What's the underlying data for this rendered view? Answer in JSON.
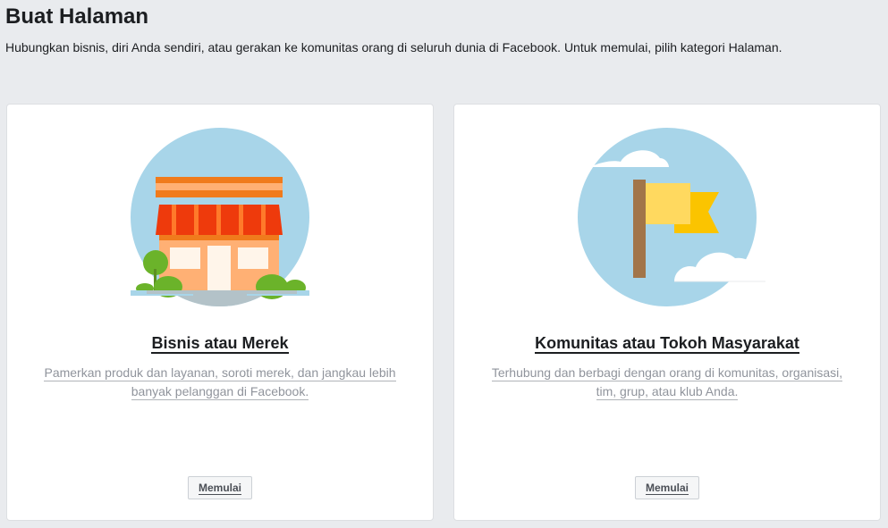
{
  "header": {
    "title": "Buat Halaman",
    "subtitle": "Hubungkan bisnis, diri Anda sendiri, atau gerakan ke komunitas orang di seluruh dunia di Facebook. Untuk memulai, pilih kategori Halaman."
  },
  "cards": [
    {
      "title": "Bisnis atau Merek",
      "description": "Pamerkan produk dan layanan, soroti merek, dan jangkau lebih banyak pelanggan di Facebook.",
      "button_label": "Memulai",
      "illustration": "storefront-icon"
    },
    {
      "title": "Komunitas atau Tokoh Masyarakat",
      "description": "Terhubung dan berbagi dengan orang di komunitas, organisasi, tim, grup, atau klub Anda.",
      "button_label": "Memulai",
      "illustration": "flag-icon"
    }
  ],
  "colors": {
    "page_background": "#e9ebee",
    "card_background": "#ffffff",
    "sky_blue": "#a8d5e9",
    "awning_red": "#ee3a0c",
    "store_orange": "#ffb074",
    "flag_yellow": "#fbc400",
    "flag_light_yellow": "#ffd95f",
    "pole_brown": "#a27549",
    "bush_green": "#6bb32a"
  }
}
